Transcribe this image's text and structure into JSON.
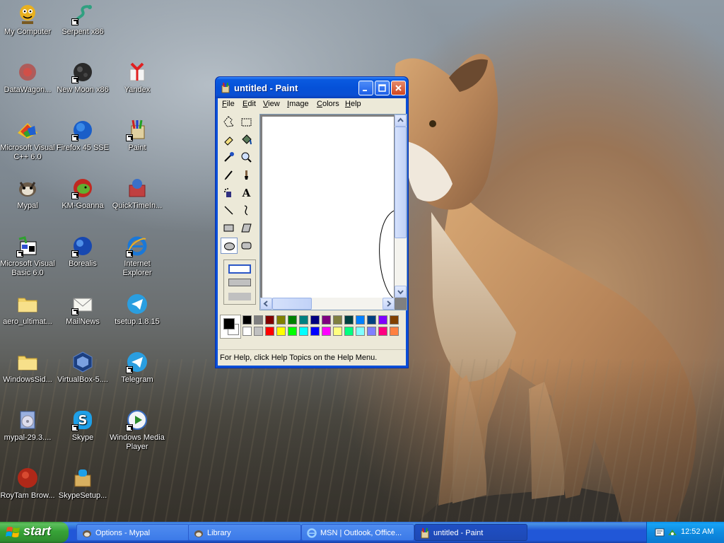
{
  "desktop": {
    "icons": [
      {
        "label": "My Computer",
        "icon": "computer-icon",
        "shortcut": false
      },
      {
        "label": "Serpent x86",
        "icon": "serpent-icon",
        "shortcut": true
      },
      {
        "label": "DataWagon...",
        "icon": "datawagon-icon",
        "shortcut": false
      },
      {
        "label": "New Moon x86",
        "icon": "new-moon-icon",
        "shortcut": true
      },
      {
        "label": "Yandex",
        "icon": "yandex-icon",
        "shortcut": false
      },
      {
        "label": "Microsoft Visual C++ 6.0",
        "icon": "visual-cpp-icon",
        "shortcut": false
      },
      {
        "label": "Firefox 45 SSE",
        "icon": "firefox-icon",
        "shortcut": true
      },
      {
        "label": "Paint",
        "icon": "paint-icon",
        "shortcut": true
      },
      {
        "label": "Mypal",
        "icon": "mypal-icon",
        "shortcut": false
      },
      {
        "label": "KM-Goanna",
        "icon": "km-goanna-icon",
        "shortcut": true
      },
      {
        "label": "QuickTimeIn...",
        "icon": "quicktime-icon",
        "shortcut": false
      },
      {
        "label": "Microsoft Visual Basic 6.0",
        "icon": "visual-basic-icon",
        "shortcut": true
      },
      {
        "label": "Borealis",
        "icon": "borealis-icon",
        "shortcut": true
      },
      {
        "label": "Internet Explorer",
        "icon": "internet-explorer-icon",
        "shortcut": true
      },
      {
        "label": "aero_ultimat...",
        "icon": "folder-icon",
        "shortcut": false
      },
      {
        "label": "MailNews",
        "icon": "mail-icon",
        "shortcut": true
      },
      {
        "label": "tsetup.1.8.15",
        "icon": "telegram-icon",
        "shortcut": false
      },
      {
        "label": "WindowsSid...",
        "icon": "folder-icon",
        "shortcut": false
      },
      {
        "label": "VirtualBox-5....",
        "icon": "virtualbox-icon",
        "shortcut": false
      },
      {
        "label": "Telegram",
        "icon": "telegram-icon",
        "shortcut": true
      },
      {
        "label": "mypal-29.3....",
        "icon": "installer-icon",
        "shortcut": false
      },
      {
        "label": "Skype",
        "icon": "skype-icon",
        "shortcut": true
      },
      {
        "label": "Windows Media Player",
        "icon": "media-player-icon",
        "shortcut": true
      },
      {
        "label": "RoyTam Brow...",
        "icon": "roytam-browser-icon",
        "shortcut": false
      },
      {
        "label": "SkypeSetup...",
        "icon": "skype-setup-icon",
        "shortcut": false
      }
    ]
  },
  "paint": {
    "title": "untitled - Paint",
    "menu": [
      "File",
      "Edit",
      "View",
      "Image",
      "Colors",
      "Help"
    ],
    "menu_mnemonics": [
      "F",
      "E",
      "V",
      "I",
      "C",
      "H"
    ],
    "tools": [
      "free-form-select",
      "select",
      "eraser",
      "fill-with-color",
      "pick-color",
      "magnifier",
      "pencil",
      "brush",
      "airbrush",
      "text",
      "line",
      "curve",
      "rectangle",
      "polygon",
      "ellipse",
      "rounded-rectangle"
    ],
    "selected_tool": "ellipse",
    "palette": [
      "#000000",
      "#808080",
      "#800000",
      "#808000",
      "#008000",
      "#008080",
      "#000080",
      "#800080",
      "#808040",
      "#004040",
      "#0080ff",
      "#004080",
      "#8000ff",
      "#804000",
      "#ffffff",
      "#c0c0c0",
      "#ff0000",
      "#ffff00",
      "#00ff00",
      "#00ffff",
      "#0000ff",
      "#ff00ff",
      "#ffff80",
      "#00ff80",
      "#80ffff",
      "#8080ff",
      "#ff0080",
      "#ff8040"
    ],
    "foreground_color": "#000000",
    "background_color": "#ffffff",
    "status": "For Help, click Help Topics on the Help Menu."
  },
  "taskbar": {
    "start_label": "start",
    "tasks": [
      {
        "label": "Options - Mypal",
        "icon": "mypal-icon",
        "active": false
      },
      {
        "label": "Library",
        "icon": "mypal-icon",
        "active": false
      },
      {
        "label": "MSN | Outlook, Office...",
        "icon": "internet-explorer-icon",
        "active": false
      },
      {
        "label": "untitled - Paint",
        "icon": "paint-icon",
        "active": true
      }
    ],
    "clock": "12:52 AM"
  }
}
